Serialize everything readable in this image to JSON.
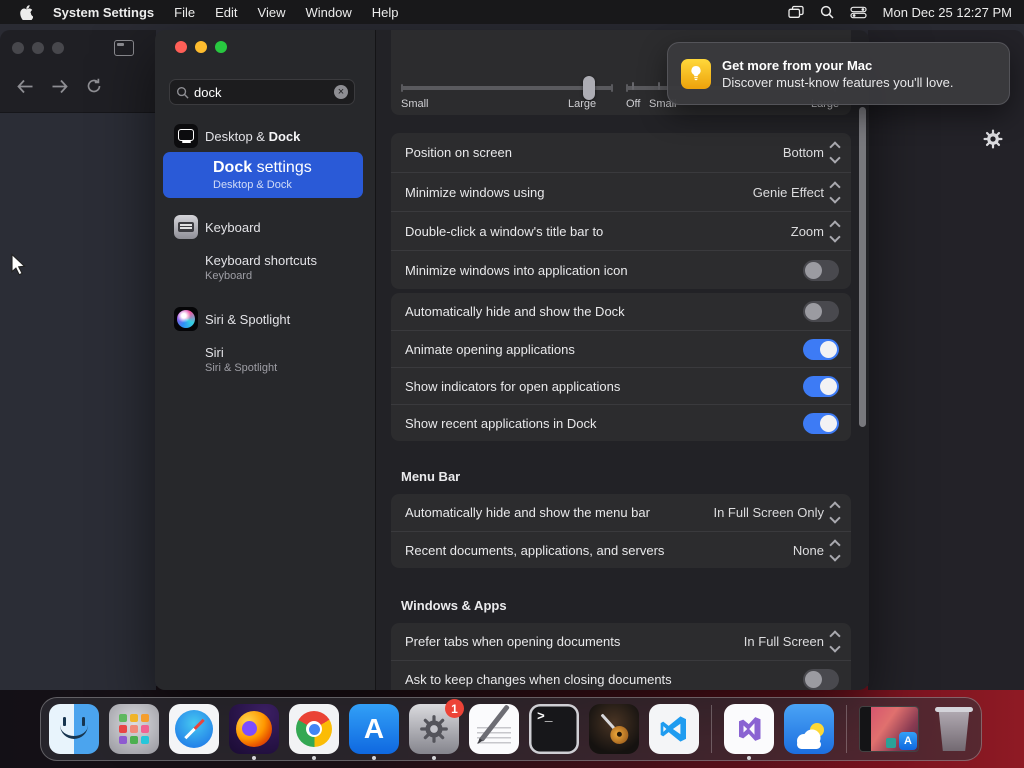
{
  "menu_bar": {
    "app_name": "System Settings",
    "menus": [
      "File",
      "Edit",
      "View",
      "Window",
      "Help"
    ],
    "clock": "Mon Dec 25 12:27 PM",
    "status_icons": [
      "stage-manager-icon",
      "search-icon",
      "control-center-icon"
    ]
  },
  "notification": {
    "title": "Get more from your Mac",
    "body": "Discover must-know features you'll love.",
    "icon": "tips-lightbulb-icon"
  },
  "settings_window": {
    "search": {
      "value": "dock"
    },
    "results": [
      {
        "prefix": "Desktop & ",
        "bold": "Dock",
        "suffix": "",
        "icon": "desktop-dock-icon"
      },
      {
        "prefix": "",
        "bold": "Dock",
        "suffix": " settings",
        "subtitle": "Desktop & Dock",
        "selected": true
      },
      {
        "prefix": "Keyboard",
        "bold": "",
        "suffix": "",
        "icon": "keyboard-icon"
      },
      {
        "prefix": "Keyboard shortcuts",
        "bold": "",
        "suffix": "",
        "subtitle": "Keyboard"
      },
      {
        "prefix": "Siri & Spotlight",
        "bold": "",
        "suffix": "",
        "icon": "siri-icon"
      },
      {
        "prefix": "Siri",
        "bold": "",
        "suffix": "",
        "subtitle": "Siri & Spotlight"
      }
    ],
    "size_slider": {
      "left_label": "Small",
      "right_label": "Large"
    },
    "magnification_slider": {
      "labels": [
        "Off",
        "Small",
        "Large"
      ]
    },
    "group_behavior": {
      "rows": [
        {
          "label": "Position on screen",
          "value": "Bottom",
          "control": "dropdown"
        },
        {
          "label": "Minimize windows using",
          "value": "Genie Effect",
          "control": "dropdown"
        },
        {
          "label": "Double-click a window's title bar to",
          "value": "Zoom",
          "control": "dropdown"
        },
        {
          "label": "Minimize windows into application icon",
          "control": "toggle",
          "on": false
        }
      ]
    },
    "group_dock_toggles": {
      "rows": [
        {
          "label": "Automatically hide and show the Dock",
          "on": false
        },
        {
          "label": "Animate opening applications",
          "on": true
        },
        {
          "label": "Show indicators for open applications",
          "on": true
        },
        {
          "label": "Show recent applications in Dock",
          "on": true
        }
      ]
    },
    "menu_bar_section": {
      "header": "Menu Bar",
      "rows": [
        {
          "label": "Automatically hide and show the menu bar",
          "value": "In Full Screen Only",
          "control": "dropdown"
        },
        {
          "label": "Recent documents, applications, and servers",
          "value": "None",
          "control": "dropdown"
        }
      ]
    },
    "windows_apps_section": {
      "header": "Windows & Apps",
      "rows": [
        {
          "label": "Prefer tabs when opening documents",
          "value": "In Full Screen",
          "control": "dropdown"
        },
        {
          "label": "Ask to keep changes when closing documents",
          "control": "toggle",
          "on": false
        }
      ]
    }
  },
  "dock": {
    "items": [
      {
        "name": "finder",
        "indicator": true
      },
      {
        "name": "launchpad",
        "indicator": false
      },
      {
        "name": "safari",
        "indicator": false
      },
      {
        "name": "firefox",
        "indicator": true
      },
      {
        "name": "chrome",
        "indicator": true
      },
      {
        "name": "app-store",
        "indicator": true,
        "glyph": "A"
      },
      {
        "name": "system-settings",
        "indicator": true,
        "badge": "1"
      },
      {
        "name": "textedit",
        "indicator": false
      },
      {
        "name": "terminal",
        "indicator": false,
        "glyph": ">_"
      },
      {
        "name": "garageband",
        "indicator": false
      },
      {
        "name": "vscode",
        "indicator": false
      },
      {
        "name": "visual-studio",
        "indicator": true
      },
      {
        "name": "weather",
        "indicator": false
      },
      {
        "name": "minimized-window",
        "indicator": false,
        "badge_glyph": "A"
      },
      {
        "name": "trash",
        "indicator": false
      }
    ]
  },
  "colors": {
    "selection_blue": "#2a5ad7",
    "toggle_on_blue": "#3d7bf5",
    "badge_red": "#ed4337",
    "notification_icon_yellow": "#f5c132",
    "traffic_red": "#ff5f57",
    "traffic_yellow": "#febc2e",
    "traffic_green": "#28c840"
  }
}
